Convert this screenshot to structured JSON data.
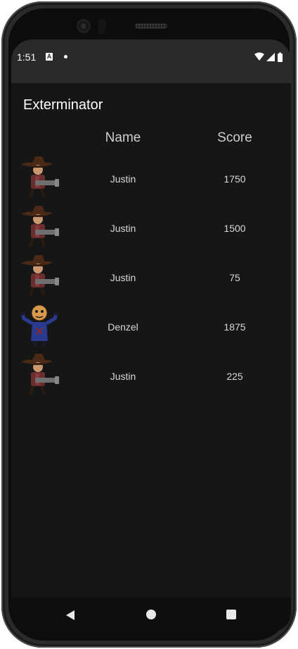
{
  "status_bar": {
    "time": "1:51",
    "notification_icon": "A",
    "icons": [
      "wifi-icon",
      "cell-signal-icon",
      "battery-icon"
    ]
  },
  "app": {
    "title": "Exterminator"
  },
  "table": {
    "headers": {
      "name": "Name",
      "score": "Score"
    },
    "rows": [
      {
        "avatar": "cowboy-gunner-icon",
        "name": "Justin",
        "score": "1750"
      },
      {
        "avatar": "cowboy-gunner-icon",
        "name": "Justin",
        "score": "1500"
      },
      {
        "avatar": "cowboy-gunner-icon",
        "name": "Justin",
        "score": "75"
      },
      {
        "avatar": "denzel-character-icon",
        "name": "Denzel",
        "score": "1875"
      },
      {
        "avatar": "cowboy-gunner-icon",
        "name": "Justin",
        "score": "225"
      }
    ]
  },
  "colors": {
    "background": "#161616",
    "status_bar": "#2a2a2a",
    "text": "#ffffff",
    "muted_text": "#cfcfcf"
  }
}
